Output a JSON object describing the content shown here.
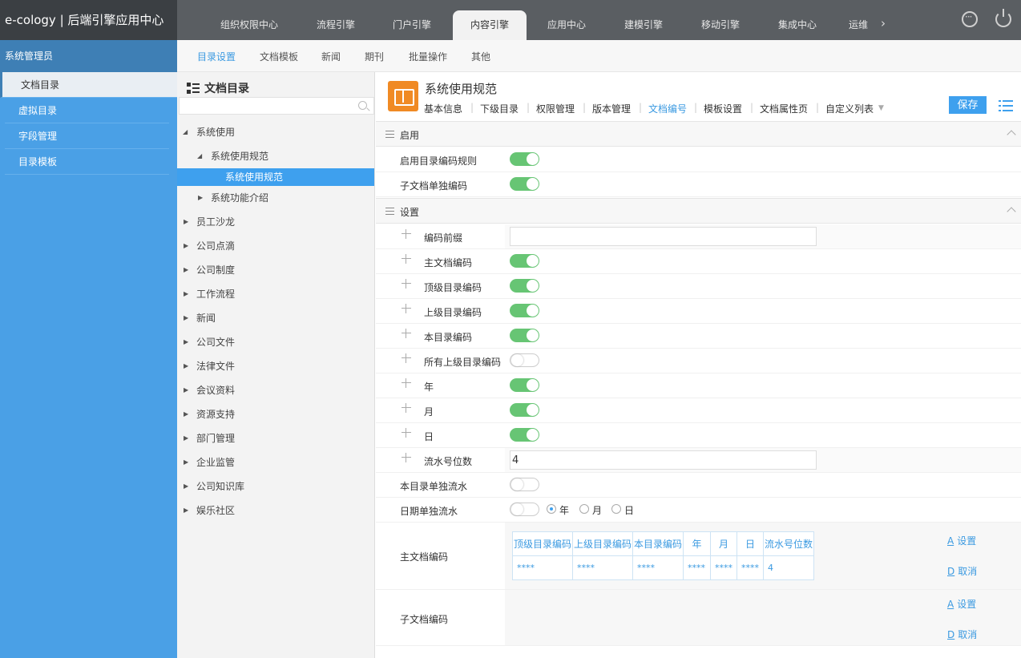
{
  "app": {
    "title": "e-cology | 后端引擎应用中心"
  },
  "top_tabs": [
    "组织权限中心",
    "流程引擎",
    "门户引擎",
    "内容引擎",
    "应用中心",
    "建模引擎",
    "移动引擎",
    "集成中心",
    "运维"
  ],
  "top_tabs_active": "内容引擎",
  "sidebar": {
    "header": "系统管理员",
    "items": [
      {
        "label": "文档目录",
        "active": true
      },
      {
        "label": "虚拟目录",
        "active": false
      },
      {
        "label": "字段管理",
        "active": false
      },
      {
        "label": "目录模板",
        "active": false
      }
    ]
  },
  "subnav": [
    "目录设置",
    "文档模板",
    "新闻",
    "期刊",
    "批量操作",
    "其他"
  ],
  "tree": {
    "title": "文档目录",
    "nodes": [
      {
        "label": "系统使用"
      },
      {
        "label": "系统使用规范"
      },
      {
        "label": "系统使用规范",
        "selected": true
      },
      {
        "label": "系统功能介绍"
      },
      {
        "label": "员工沙龙"
      },
      {
        "label": "公司点滴"
      },
      {
        "label": "公司制度"
      },
      {
        "label": "工作流程"
      },
      {
        "label": "新闻"
      },
      {
        "label": "公司文件"
      },
      {
        "label": "法律文件"
      },
      {
        "label": "会议资料"
      },
      {
        "label": "资源支持"
      },
      {
        "label": "部门管理"
      },
      {
        "label": "企业监管"
      },
      {
        "label": "公司知识库"
      },
      {
        "label": "娱乐社区"
      }
    ]
  },
  "detail": {
    "title": "系统使用规范",
    "tabs": [
      "基本信息",
      "下级目录",
      "权限管理",
      "版本管理",
      "文档编号",
      "模板设置",
      "文档属性页",
      "自定义列表"
    ],
    "active_tab": "文档编号",
    "save_label": "保存"
  },
  "section_enable": {
    "title": "启用",
    "rows": [
      {
        "label": "启用目录编码规则",
        "on": true
      },
      {
        "label": "子文档单独编码",
        "on": true
      }
    ]
  },
  "section_settings": {
    "title": "设置",
    "rows": [
      {
        "label": "编码前缀",
        "type": "input",
        "value": ""
      },
      {
        "label": "主文档编码",
        "on": true
      },
      {
        "label": "顶级目录编码",
        "on": true
      },
      {
        "label": "上级目录编码",
        "on": true
      },
      {
        "label": "本目录编码",
        "on": true
      },
      {
        "label": "所有上级目录编码",
        "on": false
      },
      {
        "label": "年",
        "on": true
      },
      {
        "label": "月",
        "on": true
      },
      {
        "label": "日",
        "on": true
      },
      {
        "label": "流水号位数",
        "type": "input",
        "value": "4"
      }
    ],
    "separate_serial": {
      "label": "本目录单独流水",
      "on": false
    },
    "date_serial": {
      "label": "日期单独流水",
      "on": false,
      "options": [
        "年",
        "月",
        "日"
      ],
      "selected": "年"
    },
    "main_code": {
      "label": "主文档编码",
      "headers": [
        "顶级目录编码",
        "上级目录编码",
        "本目录编码",
        "年",
        "月",
        "日",
        "流水号位数"
      ],
      "values": [
        "****",
        "****",
        "****",
        "****",
        "****",
        "****",
        "4"
      ]
    },
    "sub_code": {
      "label": "子文档编码"
    },
    "actions": {
      "set_key": "A",
      "set_label": "设置",
      "cancel_key": "D",
      "cancel_label": "取消"
    }
  }
}
